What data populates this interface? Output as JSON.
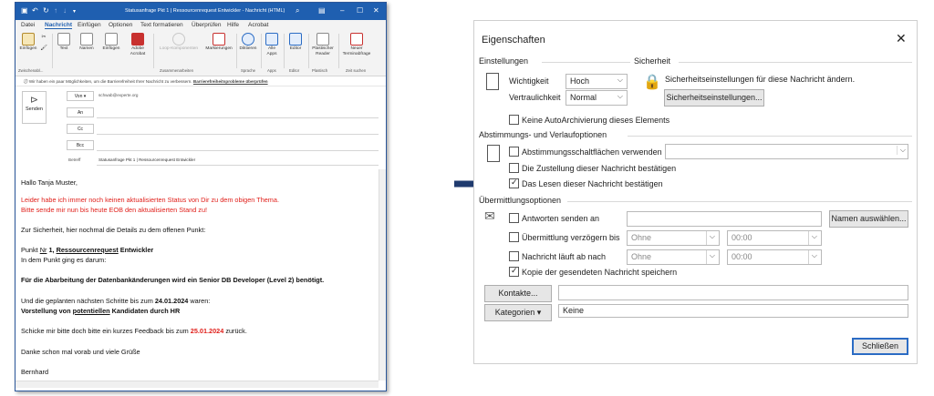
{
  "outlook": {
    "window_title": "Statusanfrage Pkt 1 | Ressourcenrequest Entwickler  -  Nachricht (HTML)",
    "menu_tabs": [
      "Datei",
      "Nachricht",
      "Einfügen",
      "Optionen",
      "Text formatieren",
      "Überprüfen",
      "Hilfe",
      "Acrobat"
    ],
    "ribbon": {
      "einfuegen": "Einfügen",
      "text": "Text",
      "namen": "Namen",
      "einfuegen2": "Einfügen",
      "adobe": "Adobe Acrobat",
      "loop": "Loop-Komponenten",
      "markierungen": "Markierungen",
      "diktieren": "Diktieren",
      "alle_apps": "Alle Apps",
      "editor": "Editor",
      "plastischer": "Plastischer Reader",
      "neuer_termin": "Neuer Terminabfrage",
      "groups": [
        "Zwischenabl...",
        "Zusammenarbeiten",
        "Sprache",
        "Apps",
        "Editor",
        "Plastisch",
        "Zeit suchen"
      ]
    },
    "infobar": "Wir haben ein paar Möglichkeiten, um die Barrierefreiheit Ihrer Nachricht zu verbessern.",
    "infobar_link": "Barrierefreiheitsprobleme überprüfen",
    "send_label": "Senden",
    "from_label": "Von",
    "from_value": "schwab@experte.org",
    "to_label": "An",
    "cc_label": "Cc",
    "bcc_label": "Bcc",
    "subject_label": "Betreff",
    "subject_value": "Statusanfrage Pkt 1 | Ressourcenrequest Entwickler",
    "body": {
      "greeting": "Hallo Tanja Muster,",
      "red1": "Leider habe ich immer noch keinen aktualisierten Status von Dir zu dem obigen Thema.",
      "red2": "Bitte sende mir nun bis heute EOB den aktualisierten Stand zu!",
      "intro": "Zur Sicherheit, hier nochmal die Details zu dem offenen Punkt:",
      "punkt_prefix": "Punkt",
      "punkt_nr": "Nr",
      "punkt_num": "1,",
      "punkt_title": "Ressourcenrequest",
      "punkt_rest": "Entwickler",
      "punkt_line2": "In dem Punkt ging es darum:",
      "bold_line": "Für die Abarbeitung der Datenbankänderungen wird ein Senior DB Developer (Level 2) benötigt.",
      "steps_prefix": "Und die geplanten nächsten Schritte bis zum",
      "steps_date": "24.01.2024",
      "steps_suffix": "waren:",
      "steps_line2a": "Vorstellung von",
      "steps_line2b": "potentiellen",
      "steps_line2c": "Kandidaten durch HR",
      "feedback_prefix": "Schicke mir bitte doch bitte ein kurzes Feedback bis zum",
      "feedback_date": "25.01.2024",
      "feedback_suffix": "zurück.",
      "thanks": "Danke schon mal vorab und viele Grüße",
      "signature": "Bernhard"
    }
  },
  "dialog": {
    "title": "Eigenschaften",
    "close_icon": "close-icon",
    "einstellungen": "Einstellungen",
    "sicherheit": "Sicherheit",
    "wichtigkeit_label": "Wichtigkeit",
    "wichtigkeit_value": "Hoch",
    "vertraulichkeit_label": "Vertraulichkeit",
    "vertraulichkeit_value": "Normal",
    "security_text": "Sicherheitseinstellungen für diese Nachricht ändern.",
    "security_button": "Sicherheitseinstellungen...",
    "no_autoarchive": "Keine AutoArchivierung dieses Elements",
    "abstimmung_header": "Abstimmungs- und Verlaufoptionen",
    "voting_buttons": "Abstimmungsschaltflächen verwenden",
    "delivery_receipt": "Die Zustellung dieser Nachricht bestätigen",
    "read_receipt": "Das Lesen dieser Nachricht bestätigen",
    "uebermittlung_header": "Übermittlungsoptionen",
    "reply_to": "Antworten senden an",
    "names_button": "Namen auswählen...",
    "delay_delivery": "Übermittlung verzögern bis",
    "expires": "Nachricht läuft ab nach",
    "none_value": "Ohne",
    "time_value": "00:00",
    "save_copy": "Kopie der gesendeten Nachricht speichern",
    "contacts_button": "Kontakte...",
    "categories_button": "Kategorien",
    "categories_value": "Keine",
    "close_button": "Schließen",
    "checks": {
      "no_autoarchive": false,
      "voting": false,
      "delivery": false,
      "read": true,
      "reply_to": false,
      "delay": false,
      "expires": false,
      "save_copy": true
    }
  },
  "colors": {
    "outlook_blue": "#1f5fb0",
    "arrow": "#1f3a6e",
    "red_text": "#e0201b"
  }
}
